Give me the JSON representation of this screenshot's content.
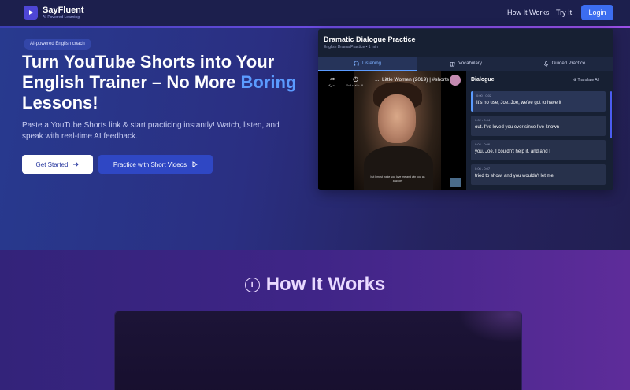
{
  "nav": {
    "brand": "SayFluent",
    "tagline": "AI-Powered Learning",
    "links": [
      "How It Works",
      "Try It"
    ],
    "login": "Login"
  },
  "hero": {
    "badge": "AI-powered English coach",
    "title_part1": "Turn YouTube Shorts into Your English Trainer – No More ",
    "title_highlight": "Boring",
    "title_part2": " Lessons!",
    "lead": "Paste a YouTube Shorts link & start practicing instantly! Watch, listen, and speak with real-time AI feedback.",
    "cta_primary": "Get Started",
    "cta_secondary": "Practice with Short Videos"
  },
  "practice": {
    "title": "Dramatic Dialogue Practice",
    "subtitle": "English Drama Practice • 1 min",
    "tabs": [
      {
        "label": "Listening",
        "icon": "headphones-icon"
      },
      {
        "label": "Vocabulary",
        "icon": "book-icon"
      },
      {
        "label": "Guided Practice",
        "icon": "microphone-icon"
      }
    ],
    "video": {
      "title": "...| Little Women (2019) | #shorts",
      "share_label": "مشاركة",
      "watch_later_label": "المشاهدة لاحقًا",
      "caption": "but I must make you love me and win you as a wooer"
    },
    "dialogue": {
      "title": "Dialogue",
      "translate": "Translate All",
      "items": [
        {
          "time": "0:00 - 0:02",
          "text": "It's no use, Joe. Joe, we've got to have it"
        },
        {
          "time": "0:02 - 0:04",
          "text": "out. I've loved you ever since I've known"
        },
        {
          "time": "0:04 - 0:06",
          "text": "you, Joe. I couldn't help it, and and I"
        },
        {
          "time": "0:06 - 0:07",
          "text": "tried to show, and you wouldn't let me"
        }
      ]
    }
  },
  "how": {
    "title": "How It Works"
  },
  "colors": {
    "accent": "#3c6df0",
    "highlight": "#5b9bff",
    "nav_bg": "#1c1f4d",
    "how_title": "#e9d9ff"
  }
}
